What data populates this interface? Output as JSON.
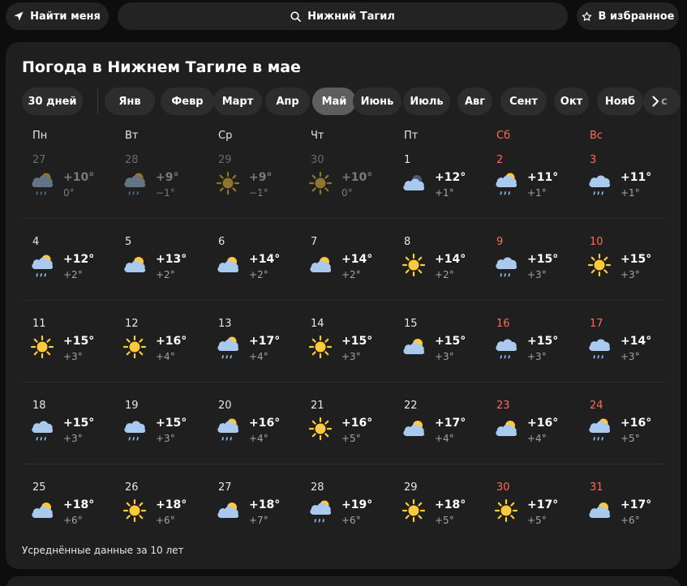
{
  "topbar": {
    "find_me_label": "Найти меня",
    "search_label": "Нижний Тагил",
    "favorite_label": "В избранное"
  },
  "title": "Погода в Нижнем Тагиле в мае",
  "chips": [
    "30 дней",
    "Янв",
    "Февр",
    "Март",
    "Апр",
    "Май",
    "Июнь",
    "Июль",
    "Авг",
    "Сент",
    "Окт",
    "Нояб"
  ],
  "active_chip": "Май",
  "next_chip_tail": "с",
  "weekdays": [
    "Пн",
    "Вт",
    "Ср",
    "Чт",
    "Пт",
    "Сб",
    "Вс"
  ],
  "days": [
    {
      "d": "27",
      "hi": "+10°",
      "lo": "0°",
      "icon": "cloud-rain-sun-icon",
      "past": true
    },
    {
      "d": "28",
      "hi": "+9°",
      "lo": "−1°",
      "icon": "cloud-rain-sun-icon",
      "past": true
    },
    {
      "d": "29",
      "hi": "+9°",
      "lo": "−1°",
      "icon": "sun-icon",
      "past": true
    },
    {
      "d": "30",
      "hi": "+10°",
      "lo": "0°",
      "icon": "sun-icon",
      "past": true
    },
    {
      "d": "1",
      "hi": "+12°",
      "lo": "+1°",
      "icon": "cloud-night-icon"
    },
    {
      "d": "2",
      "hi": "+11°",
      "lo": "+1°",
      "icon": "cloud-rain-sun-icon"
    },
    {
      "d": "3",
      "hi": "+11°",
      "lo": "+1°",
      "icon": "cloud-rain-icon"
    },
    {
      "d": "4",
      "hi": "+12°",
      "lo": "+2°",
      "icon": "cloud-rain-sun-icon"
    },
    {
      "d": "5",
      "hi": "+13°",
      "lo": "+2°",
      "icon": "cloud-sun-icon"
    },
    {
      "d": "6",
      "hi": "+14°",
      "lo": "+2°",
      "icon": "cloud-sun-icon"
    },
    {
      "d": "7",
      "hi": "+14°",
      "lo": "+2°",
      "icon": "cloud-sun-icon"
    },
    {
      "d": "8",
      "hi": "+14°",
      "lo": "+2°",
      "icon": "sun-icon"
    },
    {
      "d": "9",
      "hi": "+15°",
      "lo": "+3°",
      "icon": "cloud-rain-icon"
    },
    {
      "d": "10",
      "hi": "+15°",
      "lo": "+3°",
      "icon": "sun-icon"
    },
    {
      "d": "11",
      "hi": "+15°",
      "lo": "+3°",
      "icon": "sun-icon"
    },
    {
      "d": "12",
      "hi": "+16°",
      "lo": "+4°",
      "icon": "sun-icon"
    },
    {
      "d": "13",
      "hi": "+17°",
      "lo": "+4°",
      "icon": "cloud-rain-sun-icon"
    },
    {
      "d": "14",
      "hi": "+15°",
      "lo": "+3°",
      "icon": "sun-icon"
    },
    {
      "d": "15",
      "hi": "+15°",
      "lo": "+3°",
      "icon": "cloud-sun-icon"
    },
    {
      "d": "16",
      "hi": "+15°",
      "lo": "+3°",
      "icon": "cloud-rain-icon"
    },
    {
      "d": "17",
      "hi": "+14°",
      "lo": "+3°",
      "icon": "cloud-rain-icon"
    },
    {
      "d": "18",
      "hi": "+15°",
      "lo": "+3°",
      "icon": "cloud-rain-icon"
    },
    {
      "d": "19",
      "hi": "+15°",
      "lo": "+3°",
      "icon": "cloud-rain-icon"
    },
    {
      "d": "20",
      "hi": "+16°",
      "lo": "+4°",
      "icon": "cloud-rain-sun-icon"
    },
    {
      "d": "21",
      "hi": "+16°",
      "lo": "+5°",
      "icon": "sun-icon"
    },
    {
      "d": "22",
      "hi": "+17°",
      "lo": "+4°",
      "icon": "cloud-sun-icon"
    },
    {
      "d": "23",
      "hi": "+16°",
      "lo": "+4°",
      "icon": "cloud-sun-icon"
    },
    {
      "d": "24",
      "hi": "+16°",
      "lo": "+5°",
      "icon": "cloud-rain-sun-icon"
    },
    {
      "d": "25",
      "hi": "+18°",
      "lo": "+6°",
      "icon": "cloud-sun-icon"
    },
    {
      "d": "26",
      "hi": "+18°",
      "lo": "+6°",
      "icon": "sun-icon"
    },
    {
      "d": "27",
      "hi": "+18°",
      "lo": "+7°",
      "icon": "cloud-sun-icon"
    },
    {
      "d": "28",
      "hi": "+19°",
      "lo": "+6°",
      "icon": "cloud-rain-sun-icon"
    },
    {
      "d": "29",
      "hi": "+18°",
      "lo": "+5°",
      "icon": "sun-icon"
    },
    {
      "d": "30",
      "hi": "+17°",
      "lo": "+5°",
      "icon": "sun-icon"
    },
    {
      "d": "31",
      "hi": "+17°",
      "lo": "+6°",
      "icon": "cloud-sun-icon"
    }
  ],
  "footnote": "Усреднённые данные за 10 лет",
  "colors": {
    "weekend": "#ff6a57",
    "sun": "#ffc93c",
    "cloud": "#a9c9ee",
    "rain": "#7fb3ee"
  }
}
